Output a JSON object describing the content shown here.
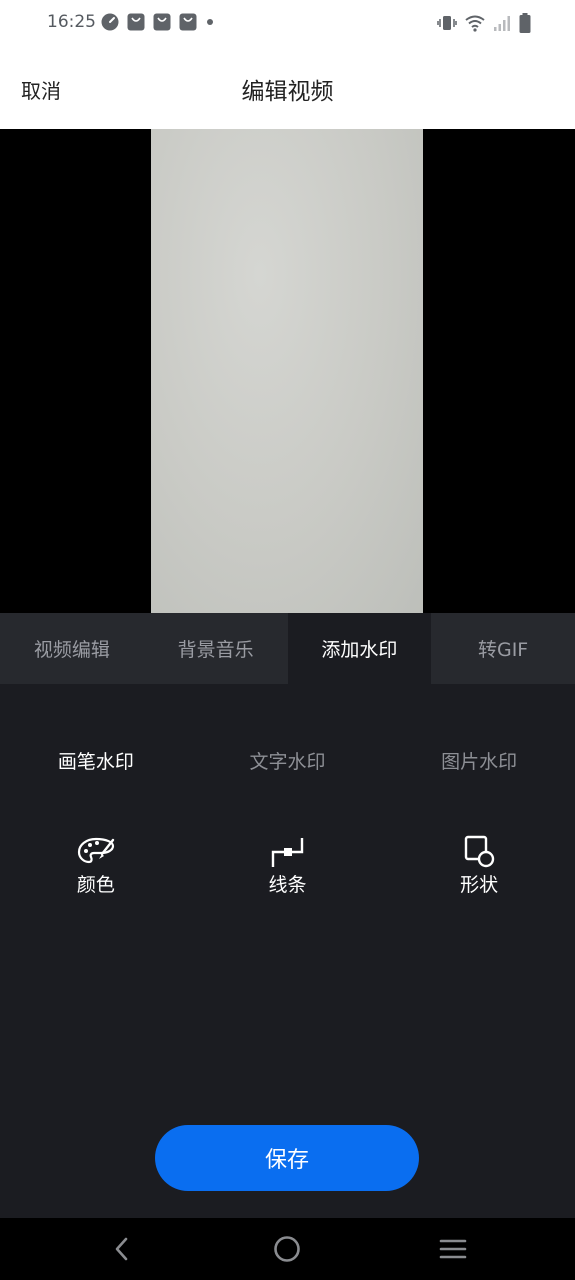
{
  "status_bar": {
    "time": "16:25",
    "left_icons": [
      "speedometer-icon",
      "bag-icon",
      "bag-icon",
      "bag-icon",
      "dot-icon"
    ],
    "right_icons": [
      "vibrate-icon",
      "wifi-icon",
      "signal-icon",
      "battery-icon"
    ]
  },
  "header": {
    "cancel_label": "取消",
    "title": "编辑视频"
  },
  "tabs": [
    {
      "label": "视频编辑",
      "active": false
    },
    {
      "label": "背景音乐",
      "active": false
    },
    {
      "label": "添加水印",
      "active": true
    },
    {
      "label": "转GIF",
      "active": false
    }
  ],
  "subtabs": [
    {
      "label": "画笔水印",
      "active": true
    },
    {
      "label": "文字水印",
      "active": false
    },
    {
      "label": "图片水印",
      "active": false
    }
  ],
  "tools": [
    {
      "label": "颜色",
      "icon": "palette-icon"
    },
    {
      "label": "线条",
      "icon": "line-icon"
    },
    {
      "label": "形状",
      "icon": "shape-icon"
    }
  ],
  "save_label": "保存",
  "nav": [
    "back-icon",
    "home-icon",
    "menu-icon"
  ],
  "colors": {
    "accent": "#0a6ef0",
    "panel_bg": "#1b1c21",
    "tab_bg": "#27292e"
  }
}
